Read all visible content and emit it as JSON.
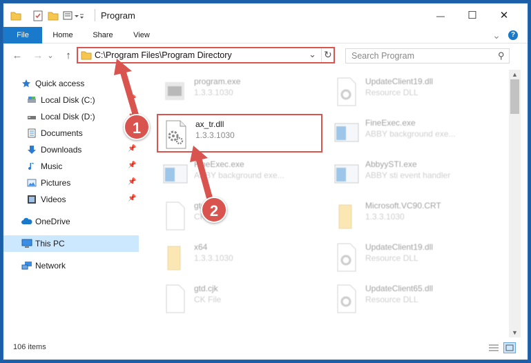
{
  "window": {
    "title": "Program",
    "minimize_glyph": "—",
    "maximize_glyph": "☐",
    "close_glyph": "✕"
  },
  "ribbon": {
    "tabs": [
      "File",
      "Home",
      "Share",
      "View"
    ],
    "help_glyph": "?",
    "expand_glyph": "⌄"
  },
  "nav": {
    "back_glyph": "←",
    "forward_glyph": "→",
    "recent_glyph": "⌄",
    "up_glyph": "↑",
    "address": "C:\\Program Files\\Program Directory",
    "refresh_glyph": "↻",
    "search_placeholder": "Search Program",
    "search_glyph": "⚲"
  },
  "sidebar": {
    "items": [
      {
        "label": "Quick access",
        "icon": "star-icon",
        "pinned": false
      },
      {
        "label": "Local Disk (C:)",
        "icon": "drive-icon",
        "pinned": true
      },
      {
        "label": "Local Disk (D:)",
        "icon": "drive-icon",
        "pinned": true
      },
      {
        "label": "Documents",
        "icon": "documents-icon",
        "pinned": true
      },
      {
        "label": "Downloads",
        "icon": "downloads-icon",
        "pinned": true
      },
      {
        "label": "Music",
        "icon": "music-icon",
        "pinned": true
      },
      {
        "label": "Pictures",
        "icon": "pictures-icon",
        "pinned": true
      },
      {
        "label": "Videos",
        "icon": "videos-icon",
        "pinned": true
      },
      {
        "label": "OneDrive",
        "icon": "cloud-icon",
        "pinned": false
      },
      {
        "label": "This PC",
        "icon": "pc-icon",
        "pinned": false
      },
      {
        "label": "Network",
        "icon": "network-icon",
        "pinned": false
      }
    ],
    "pin_glyph": "📌"
  },
  "files": [
    {
      "name": "program.exe",
      "sub": "1.3.3.1030"
    },
    {
      "name": "UpdateClient19.dll",
      "sub": "Resource DLL"
    },
    {
      "name": "ax_tr.dll",
      "sub": "1.3.3.1030"
    },
    {
      "name": "FineExec.exe",
      "sub": "ABBY background exe..."
    },
    {
      "name": "FineExec.exe",
      "sub": "ABBY background exe..."
    },
    {
      "name": "AbbyySTI.exe",
      "sub": "ABBY sti event handler"
    },
    {
      "name": "gtd",
      "sub": "CK"
    },
    {
      "name": "Microsoft.VC90.CRT",
      "sub": "1.3.3.1030"
    },
    {
      "name": "x64",
      "sub": "1.3.3.1030"
    },
    {
      "name": "UpdateClient19.dll",
      "sub": "Resource DLL"
    },
    {
      "name": "gtd.cjk",
      "sub": "CK File"
    },
    {
      "name": "UpdateClient65.dll",
      "sub": "Resource DLL"
    }
  ],
  "status": {
    "count": "106 items"
  },
  "annotations": {
    "badge1": "1",
    "badge2": "2"
  },
  "colors": {
    "accent": "#1979ca",
    "highlight": "#d9534f",
    "selection": "#cce8ff",
    "folder": "#f5c74e"
  }
}
